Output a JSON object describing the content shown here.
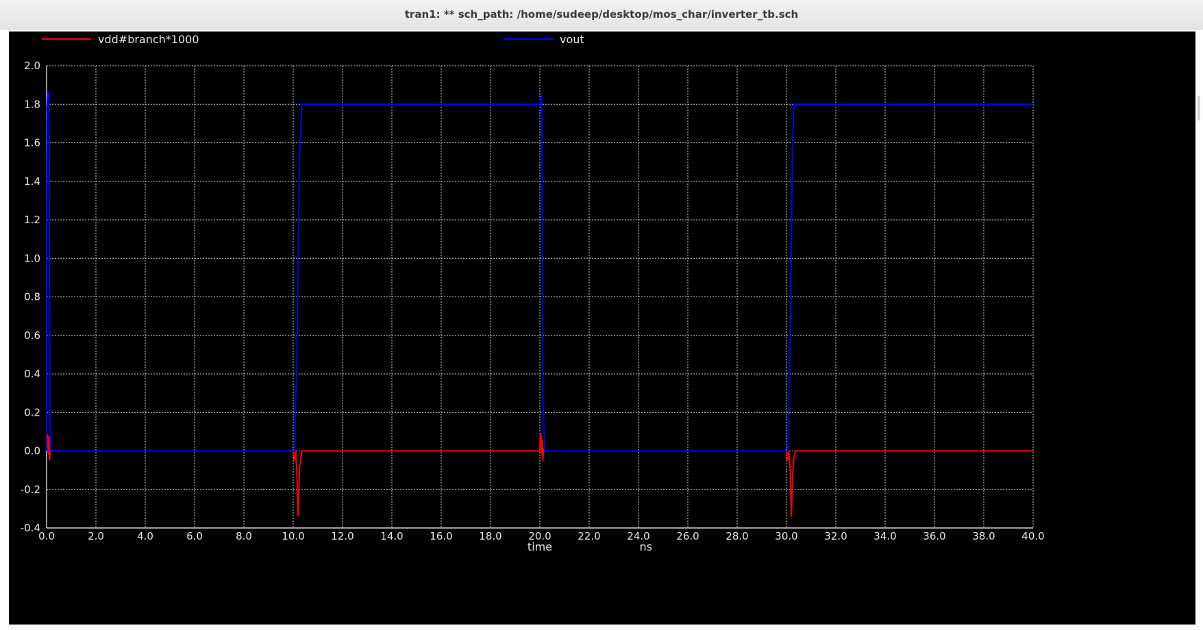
{
  "window": {
    "title": "tran1: ** sch_path: /home/sudeep/desktop/mos_char/inverter_tb.sch"
  },
  "chart_data": {
    "type": "line",
    "xlabel": "time",
    "xunit": "ns",
    "ylabel": "",
    "xlim": [
      0,
      40
    ],
    "ylim": [
      -0.4,
      2.0
    ],
    "grid": true,
    "background": "#000000",
    "grid_color": "#d0d0d0",
    "x_ticks": [
      "0.0",
      "2.0",
      "4.0",
      "6.0",
      "8.0",
      "10.0",
      "12.0",
      "14.0",
      "16.0",
      "18.0",
      "20.0",
      "22.0",
      "24.0",
      "26.0",
      "28.0",
      "30.0",
      "32.0",
      "34.0",
      "36.0",
      "38.0",
      "40.0"
    ],
    "y_ticks": [
      "2.0",
      "1.8",
      "1.6",
      "1.4",
      "1.2",
      "1.0",
      "0.8",
      "0.6",
      "0.4",
      "0.2",
      "0.0",
      "-0.2",
      "-0.4"
    ],
    "legend_placement": "top",
    "series": [
      {
        "name": "vdd#branch*1000",
        "color": "#ff0000",
        "x": [
          0.0,
          0.02,
          0.05,
          0.08,
          0.1,
          0.12,
          0.15,
          0.2,
          10.0,
          10.05,
          10.1,
          10.15,
          10.2,
          10.25,
          10.3,
          10.35,
          10.4,
          20.0,
          20.02,
          20.05,
          20.08,
          20.1,
          20.12,
          20.15,
          20.2,
          30.0,
          30.05,
          30.1,
          30.15,
          30.2,
          30.25,
          30.3,
          30.35,
          30.4,
          40.0
        ],
        "y": [
          0.0,
          0.09,
          0.06,
          -0.02,
          0.08,
          -0.05,
          0.01,
          0.0,
          0.0,
          -0.05,
          0.0,
          -0.12,
          -0.34,
          -0.1,
          -0.05,
          0.0,
          0.0,
          0.0,
          0.09,
          0.08,
          -0.02,
          0.06,
          -0.05,
          0.01,
          0.0,
          0.0,
          -0.05,
          0.0,
          -0.1,
          -0.34,
          -0.12,
          -0.04,
          0.0,
          0.0,
          0.0
        ]
      },
      {
        "name": "vout",
        "color": "#0000ff",
        "x": [
          0.0,
          0.02,
          0.05,
          0.07,
          0.1,
          0.13,
          0.16,
          10.05,
          10.15,
          10.25,
          10.35,
          10.4,
          20.0,
          20.05,
          20.08,
          20.12,
          20.2,
          30.05,
          30.15,
          30.25,
          30.3,
          30.35,
          40.0
        ],
        "y": [
          0.0,
          1.8,
          1.86,
          1.82,
          1.86,
          0.3,
          0.0,
          0.0,
          0.5,
          1.5,
          1.8,
          1.8,
          1.8,
          1.85,
          1.8,
          0.3,
          0.0,
          0.0,
          0.6,
          1.6,
          1.8,
          1.8,
          1.8
        ]
      }
    ]
  }
}
